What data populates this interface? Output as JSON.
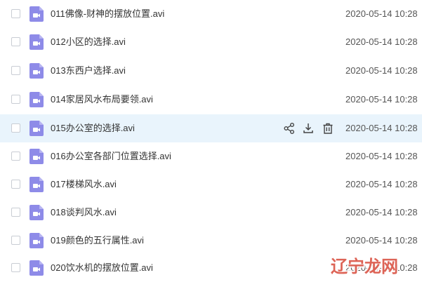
{
  "files": [
    {
      "name": "011佛像-财神的摆放位置.avi",
      "date": "2020-05-14 10:28"
    },
    {
      "name": "012小区的选择.avi",
      "date": "2020-05-14 10:28"
    },
    {
      "name": "013东西户选择.avi",
      "date": "2020-05-14 10:28"
    },
    {
      "name": "014家居风水布局要领.avi",
      "date": "2020-05-14 10:28"
    },
    {
      "name": "015办公室的选择.avi",
      "date": "2020-05-14 10:28"
    },
    {
      "name": "016办公室各部门位置选择.avi",
      "date": "2020-05-14 10:28"
    },
    {
      "name": "017楼梯风水.avi",
      "date": "2020-05-14 10:28"
    },
    {
      "name": "018谈判风水.avi",
      "date": "2020-05-14 10:28"
    },
    {
      "name": "019颜色的五行属性.avi",
      "date": "2020-05-14 10:28"
    },
    {
      "name": "020饮水机的摆放位置.avi",
      "date": "2020-05-14 10:28"
    }
  ],
  "icons": {
    "file": "video-file-icon",
    "share": "share-icon",
    "download": "download-icon",
    "delete": "trash-icon"
  },
  "colors": {
    "video_icon": "#8e8be8",
    "hover_row": "#e9f4fc",
    "watermark": "#d84a3a"
  },
  "watermark": {
    "text": "辽宁龙网"
  }
}
